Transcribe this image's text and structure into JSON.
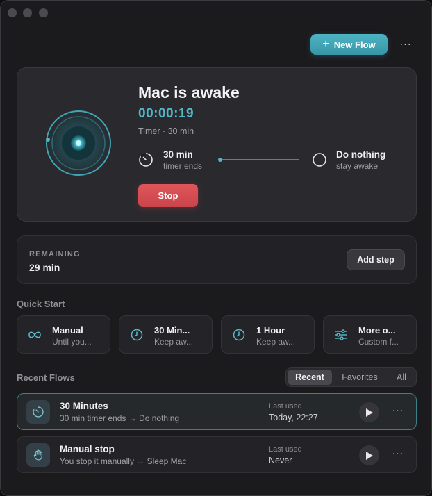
{
  "toolbar": {
    "new_flow_label": "New Flow",
    "more_label": "···"
  },
  "hero": {
    "title": "Mac is awake",
    "elapsed": "00:00:19",
    "subtitle": "Timer · 30 min",
    "step_from": {
      "title": "30 min",
      "sub": "timer ends",
      "icon": "timer-icon"
    },
    "step_to": {
      "title": "Do nothing",
      "sub": "stay awake",
      "icon": "circle-icon"
    },
    "stop_label": "Stop"
  },
  "remaining": {
    "label": "REMAINING",
    "value": "29 min",
    "add_step_label": "Add step"
  },
  "quick_start": {
    "heading": "Quick Start",
    "items": [
      {
        "title": "Manual",
        "sub": "Until you...",
        "icon": "infinity-icon"
      },
      {
        "title": "30 Min...",
        "sub": "Keep aw...",
        "icon": "clock-icon"
      },
      {
        "title": "1 Hour",
        "sub": "Keep aw...",
        "icon": "clock-icon"
      },
      {
        "title": "More o...",
        "sub": "Custom f...",
        "icon": "sliders-icon"
      }
    ]
  },
  "recent": {
    "heading": "Recent Flows",
    "tabs": [
      "Recent",
      "Favorites",
      "All"
    ],
    "active_tab": "Recent",
    "rows": [
      {
        "title": "30 Minutes",
        "sub": "30 min timer ends → Do nothing",
        "last_label": "Last used",
        "last_value": "Today, 22:27",
        "icon": "timer-icon"
      },
      {
        "title": "Manual stop",
        "sub": "You stop it manually → Sleep Mac",
        "last_label": "Last used",
        "last_value": "Never",
        "icon": "hand-icon"
      }
    ]
  },
  "colors": {
    "accent": "#4fb7c8",
    "stop": "#d94d53",
    "background": "#1b1b1e"
  }
}
